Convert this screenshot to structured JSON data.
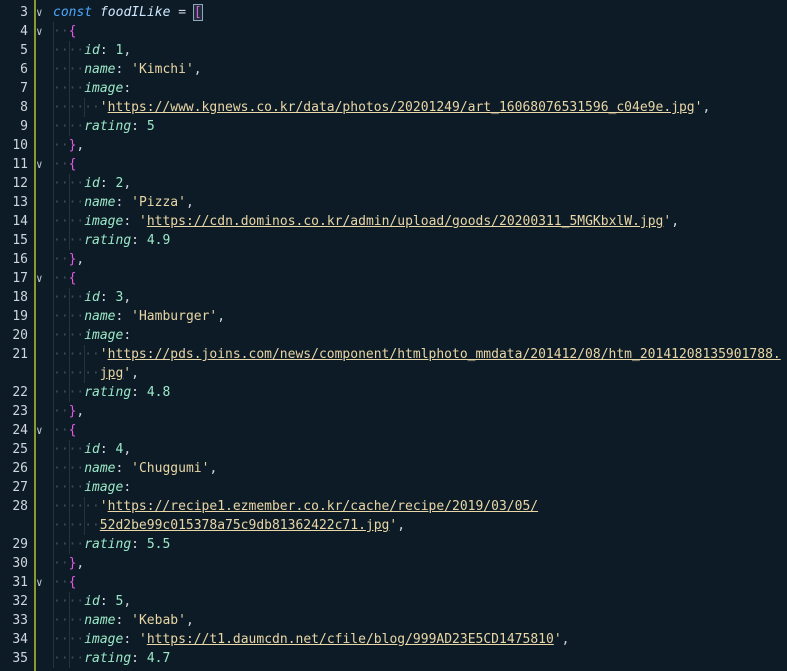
{
  "editor": {
    "lines": [
      {
        "n": "3",
        "fold": true,
        "indent": 0,
        "tokens": [
          [
            "kw",
            "const "
          ],
          [
            "var",
            "foodILike"
          ],
          [
            "punc",
            " = "
          ],
          [
            "brace-hl",
            "["
          ]
        ]
      },
      {
        "n": "4",
        "fold": true,
        "indent": 1,
        "tokens": [
          [
            "brace",
            "{"
          ]
        ]
      },
      {
        "n": "5",
        "fold": false,
        "indent": 2,
        "tokens": [
          [
            "prop",
            "id"
          ],
          [
            "punc",
            ": "
          ],
          [
            "num",
            "1"
          ],
          [
            "punc",
            ","
          ]
        ]
      },
      {
        "n": "6",
        "fold": false,
        "indent": 2,
        "tokens": [
          [
            "prop",
            "name"
          ],
          [
            "punc",
            ": "
          ],
          [
            "str",
            "'Kimchi'"
          ],
          [
            "punc",
            ","
          ]
        ]
      },
      {
        "n": "7",
        "fold": false,
        "indent": 2,
        "tokens": [
          [
            "prop",
            "image"
          ],
          [
            "punc",
            ":"
          ]
        ]
      },
      {
        "n": "8",
        "fold": false,
        "indent": 3,
        "tokens": [
          [
            "str",
            "'"
          ],
          [
            "url",
            "https://www.kgnews.co.kr/data/photos/20201249/art_16068076531596_c04e9e.jpg"
          ],
          [
            "str",
            "'"
          ],
          [
            "punc",
            ","
          ]
        ]
      },
      {
        "n": "9",
        "fold": false,
        "indent": 2,
        "tokens": [
          [
            "prop",
            "rating"
          ],
          [
            "punc",
            ": "
          ],
          [
            "num",
            "5"
          ]
        ]
      },
      {
        "n": "10",
        "fold": false,
        "indent": 1,
        "tokens": [
          [
            "brace",
            "}"
          ],
          [
            "punc",
            ","
          ]
        ]
      },
      {
        "n": "11",
        "fold": true,
        "indent": 1,
        "tokens": [
          [
            "brace",
            "{"
          ]
        ]
      },
      {
        "n": "12",
        "fold": false,
        "indent": 2,
        "tokens": [
          [
            "prop",
            "id"
          ],
          [
            "punc",
            ": "
          ],
          [
            "num",
            "2"
          ],
          [
            "punc",
            ","
          ]
        ]
      },
      {
        "n": "13",
        "fold": false,
        "indent": 2,
        "tokens": [
          [
            "prop",
            "name"
          ],
          [
            "punc",
            ": "
          ],
          [
            "str",
            "'Pizza'"
          ],
          [
            "punc",
            ","
          ]
        ]
      },
      {
        "n": "14",
        "fold": false,
        "indent": 2,
        "tokens": [
          [
            "prop",
            "image"
          ],
          [
            "punc",
            ": "
          ],
          [
            "str",
            "'"
          ],
          [
            "url",
            "https://cdn.dominos.co.kr/admin/upload/goods/20200311_5MGKbxlW.jpg"
          ],
          [
            "str",
            "'"
          ],
          [
            "punc",
            ","
          ]
        ]
      },
      {
        "n": "15",
        "fold": false,
        "indent": 2,
        "tokens": [
          [
            "prop",
            "rating"
          ],
          [
            "punc",
            ": "
          ],
          [
            "num",
            "4.9"
          ]
        ]
      },
      {
        "n": "16",
        "fold": false,
        "indent": 1,
        "tokens": [
          [
            "brace",
            "}"
          ],
          [
            "punc",
            ","
          ]
        ]
      },
      {
        "n": "17",
        "fold": true,
        "indent": 1,
        "tokens": [
          [
            "brace",
            "{"
          ]
        ]
      },
      {
        "n": "18",
        "fold": false,
        "indent": 2,
        "tokens": [
          [
            "prop",
            "id"
          ],
          [
            "punc",
            ": "
          ],
          [
            "num",
            "3"
          ],
          [
            "punc",
            ","
          ]
        ]
      },
      {
        "n": "19",
        "fold": false,
        "indent": 2,
        "tokens": [
          [
            "prop",
            "name"
          ],
          [
            "punc",
            ": "
          ],
          [
            "str",
            "'Hamburger'"
          ],
          [
            "punc",
            ","
          ]
        ]
      },
      {
        "n": "20",
        "fold": false,
        "indent": 2,
        "tokens": [
          [
            "prop",
            "image"
          ],
          [
            "punc",
            ":"
          ]
        ]
      },
      {
        "n": "21",
        "fold": false,
        "indent": 3,
        "tokens": [
          [
            "str",
            "'"
          ],
          [
            "url",
            "https://pds.joins.com/news/component/htmlphoto_mmdata/201412/08/htm_20141208135901788."
          ]
        ]
      },
      {
        "n": "",
        "fold": false,
        "indent": 3,
        "wrap": true,
        "tokens": [
          [
            "url",
            "jpg"
          ],
          [
            "str",
            "'"
          ],
          [
            "punc",
            ","
          ]
        ]
      },
      {
        "n": "22",
        "fold": false,
        "indent": 2,
        "tokens": [
          [
            "prop",
            "rating"
          ],
          [
            "punc",
            ": "
          ],
          [
            "num",
            "4.8"
          ]
        ]
      },
      {
        "n": "23",
        "fold": false,
        "indent": 1,
        "tokens": [
          [
            "brace",
            "}"
          ],
          [
            "punc",
            ","
          ]
        ]
      },
      {
        "n": "24",
        "fold": true,
        "indent": 1,
        "tokens": [
          [
            "brace",
            "{"
          ]
        ]
      },
      {
        "n": "25",
        "fold": false,
        "indent": 2,
        "tokens": [
          [
            "prop",
            "id"
          ],
          [
            "punc",
            ": "
          ],
          [
            "num",
            "4"
          ],
          [
            "punc",
            ","
          ]
        ]
      },
      {
        "n": "26",
        "fold": false,
        "indent": 2,
        "tokens": [
          [
            "prop",
            "name"
          ],
          [
            "punc",
            ": "
          ],
          [
            "str",
            "'Chuggumi'"
          ],
          [
            "punc",
            ","
          ]
        ]
      },
      {
        "n": "27",
        "fold": false,
        "indent": 2,
        "tokens": [
          [
            "prop",
            "image"
          ],
          [
            "punc",
            ":"
          ]
        ]
      },
      {
        "n": "28",
        "fold": false,
        "indent": 3,
        "tokens": [
          [
            "str",
            "'"
          ],
          [
            "url",
            "https://recipe1.ezmember.co.kr/cache/recipe/2019/03/05/"
          ]
        ]
      },
      {
        "n": "",
        "fold": false,
        "indent": 3,
        "wrap": true,
        "tokens": [
          [
            "url",
            "52d2be99c015378a75c9db81362422c71.jpg"
          ],
          [
            "str",
            "'"
          ],
          [
            "punc",
            ","
          ]
        ]
      },
      {
        "n": "29",
        "fold": false,
        "indent": 2,
        "tokens": [
          [
            "prop",
            "rating"
          ],
          [
            "punc",
            ": "
          ],
          [
            "num",
            "5.5"
          ]
        ]
      },
      {
        "n": "30",
        "fold": false,
        "indent": 1,
        "tokens": [
          [
            "brace",
            "}"
          ],
          [
            "punc",
            ","
          ]
        ]
      },
      {
        "n": "31",
        "fold": true,
        "indent": 1,
        "tokens": [
          [
            "brace",
            "{"
          ]
        ]
      },
      {
        "n": "32",
        "fold": false,
        "indent": 2,
        "tokens": [
          [
            "prop",
            "id"
          ],
          [
            "punc",
            ": "
          ],
          [
            "num",
            "5"
          ],
          [
            "punc",
            ","
          ]
        ]
      },
      {
        "n": "33",
        "fold": false,
        "indent": 2,
        "tokens": [
          [
            "prop",
            "name"
          ],
          [
            "punc",
            ": "
          ],
          [
            "str",
            "'Kebab'"
          ],
          [
            "punc",
            ","
          ]
        ]
      },
      {
        "n": "34",
        "fold": false,
        "indent": 2,
        "tokens": [
          [
            "prop",
            "image"
          ],
          [
            "punc",
            ": "
          ],
          [
            "str",
            "'"
          ],
          [
            "url",
            "https://t1.daumcdn.net/cfile/blog/999AD23E5CD1475810"
          ],
          [
            "str",
            "'"
          ],
          [
            "punc",
            ","
          ]
        ]
      },
      {
        "n": "35",
        "fold": false,
        "indent": 2,
        "tokens": [
          [
            "prop",
            "rating"
          ],
          [
            "punc",
            ": "
          ],
          [
            "num",
            "4.7"
          ]
        ]
      }
    ]
  },
  "icons": {
    "fold": "chevron-down-icon"
  },
  "colors": {
    "background": "#0d1b26",
    "accent_bar": "#8a9a2a",
    "keyword": "#4aa8ff",
    "string": "#e8d6a6",
    "property": "#9be8c8",
    "brace": "#e05be0"
  }
}
